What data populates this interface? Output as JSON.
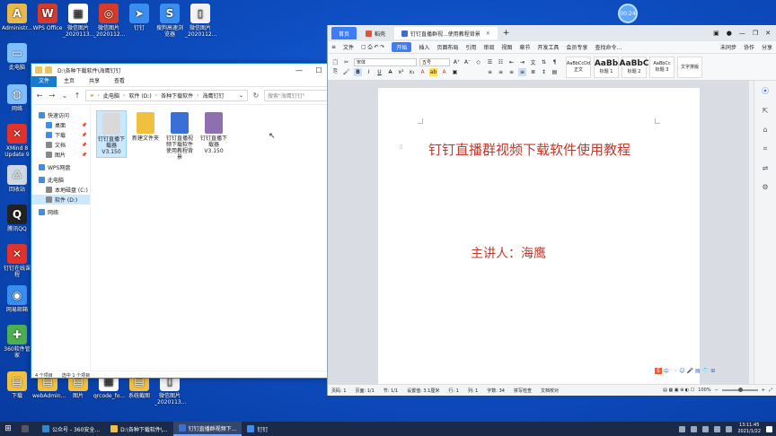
{
  "desktop": {
    "icons": [
      {
        "label": "Administr...",
        "glyph": "A",
        "color": "#e8b84a"
      },
      {
        "label": "WPS Office",
        "glyph": "W",
        "color": "#d63a2a"
      },
      {
        "label": "微信图片_2020113...",
        "glyph": "▦",
        "color": "#ffffff"
      },
      {
        "label": "微信图片_2020112...",
        "glyph": "◎",
        "color": "#d63a2a"
      },
      {
        "label": "钉钉",
        "glyph": "➤",
        "color": "#3a8ef0"
      },
      {
        "label": "搜狗高速浏览器",
        "glyph": "S",
        "color": "#3a8ef0"
      },
      {
        "label": "微信图片_2020112...",
        "glyph": "▯",
        "color": "#f2f2f2"
      },
      {
        "label": "此电脑",
        "glyph": "▭",
        "color": "#7ec0ff"
      },
      {
        "label": "网络",
        "glyph": "◍",
        "color": "#7ec0ff"
      },
      {
        "label": "XMind 8 Update 9",
        "glyph": "✕",
        "color": "#e0332b"
      },
      {
        "label": "回收站",
        "glyph": "♺",
        "color": "#cfd8e3"
      },
      {
        "label": "腾讯QQ",
        "glyph": "Q",
        "color": "#222222"
      },
      {
        "label": "钉钉在线课程",
        "glyph": "✕",
        "color": "#e0332b"
      },
      {
        "label": "网易邮箱",
        "glyph": "◉",
        "color": "#3a8ef0"
      },
      {
        "label": "360软件管家",
        "glyph": "✚",
        "color": "#4caf50"
      },
      {
        "label": "下载",
        "glyph": "▤",
        "color": "#f0c040"
      },
      {
        "label": "webAdmin...",
        "glyph": "▤",
        "color": "#f0c040"
      },
      {
        "label": "图片",
        "glyph": "▤",
        "color": "#f0c040"
      },
      {
        "label": "qrcode_fo...",
        "glyph": "▦",
        "color": "#ffffff"
      },
      {
        "label": "系统截图",
        "glyph": "▤",
        "color": "#f0c040"
      },
      {
        "label": "微信图片_2020113...",
        "glyph": "▯",
        "color": "#f2f2f2"
      }
    ],
    "clock_badge": "00:24"
  },
  "explorer": {
    "title": "D:\\各种下载软件\\海鹰钉钉",
    "ribbon": [
      "文件",
      "主页",
      "共享",
      "查看"
    ],
    "address": [
      "此电脑",
      "软件 (D:)",
      "各种下载软件",
      "海鹰钉钉"
    ],
    "search_placeholder": "搜索\"海鹰钉钉\"",
    "sidebar": [
      {
        "label": "快速访问",
        "color": "#3a8ef0"
      },
      {
        "label": "桌面",
        "color": "#3a8ef0"
      },
      {
        "label": "下载",
        "color": "#3a8ef0"
      },
      {
        "label": "文档",
        "color": "#888888"
      },
      {
        "label": "图片",
        "color": "#888888"
      },
      {
        "label": "WPS网盘",
        "color": "#3a8ef0"
      },
      {
        "label": "此电脑",
        "color": "#3a8ef0"
      },
      {
        "label": "本地磁盘 (C:)",
        "color": "#888888"
      },
      {
        "label": "软件 (D:)",
        "color": "#888888"
      },
      {
        "label": "网络",
        "color": "#3a8ef0"
      }
    ],
    "files": [
      {
        "label": "钉钉直播下载器 V3.150",
        "color": "#d9d9d9"
      },
      {
        "label": "新建文件夹",
        "color": "#f0c040"
      },
      {
        "label": "钉钉直播视频下载软件使用教程背景",
        "color": "#3a6fd8"
      },
      {
        "label": "钉钉直播下载器 V3.150",
        "color": "#8e6fb0"
      }
    ],
    "status_items": "4 个项目",
    "status_selected": "选中 1 个项目"
  },
  "wps": {
    "tabs": {
      "home": "首页",
      "t2": "稻壳",
      "doc": "钉钉直播群视...使用教程背景"
    },
    "menu": [
      "文件",
      "开始",
      "插入",
      "页面布局",
      "引用",
      "审阅",
      "视图",
      "章节",
      "开发工具",
      "会员专享",
      "查找命令..."
    ],
    "menu_right": [
      "未同步",
      "协作",
      "分享"
    ],
    "font_name": "宋体",
    "font_size": "五号",
    "styles": [
      {
        "preview": "AaBbCcDd",
        "name": "正文"
      },
      {
        "preview": "AaBb",
        "name": "标题 1"
      },
      {
        "preview": "AaBbC",
        "name": "标题 2"
      },
      {
        "preview": "AaBbCc",
        "name": "标题 3"
      },
      {
        "preview": "文字排版",
        "name": ""
      }
    ],
    "doc_title": "钉钉直播群视频下载软件使用教程",
    "doc_sub": "主讲人：海鹰",
    "status": {
      "page": "页码: 1",
      "pages": "页面: 1/1",
      "section": "节: 1/1",
      "setting": "设置值: 3.1厘米",
      "row": "行: 1",
      "col": "列: 1",
      "words": "字数: 34",
      "spell": "拼写检查",
      "proof": "文档校对",
      "zoom": "100%"
    }
  },
  "ime": [
    "S",
    "中",
    "·",
    "◦",
    "☺",
    "🎤",
    "▤",
    "👕",
    "⊞"
  ],
  "taskbar": {
    "items": [
      {
        "label": "",
        "color": "#556"
      },
      {
        "label": "公众号 - 360安全...",
        "color": "#38c"
      },
      {
        "label": "D:\\各种下载软件\\...",
        "color": "#f0c040"
      },
      {
        "label": "钉钉直播群视频下...",
        "color": "#3a6fd8"
      },
      {
        "label": "钉钉",
        "color": "#3a8ef0"
      }
    ],
    "time": "13:11:45",
    "date": "2021/1/22"
  }
}
